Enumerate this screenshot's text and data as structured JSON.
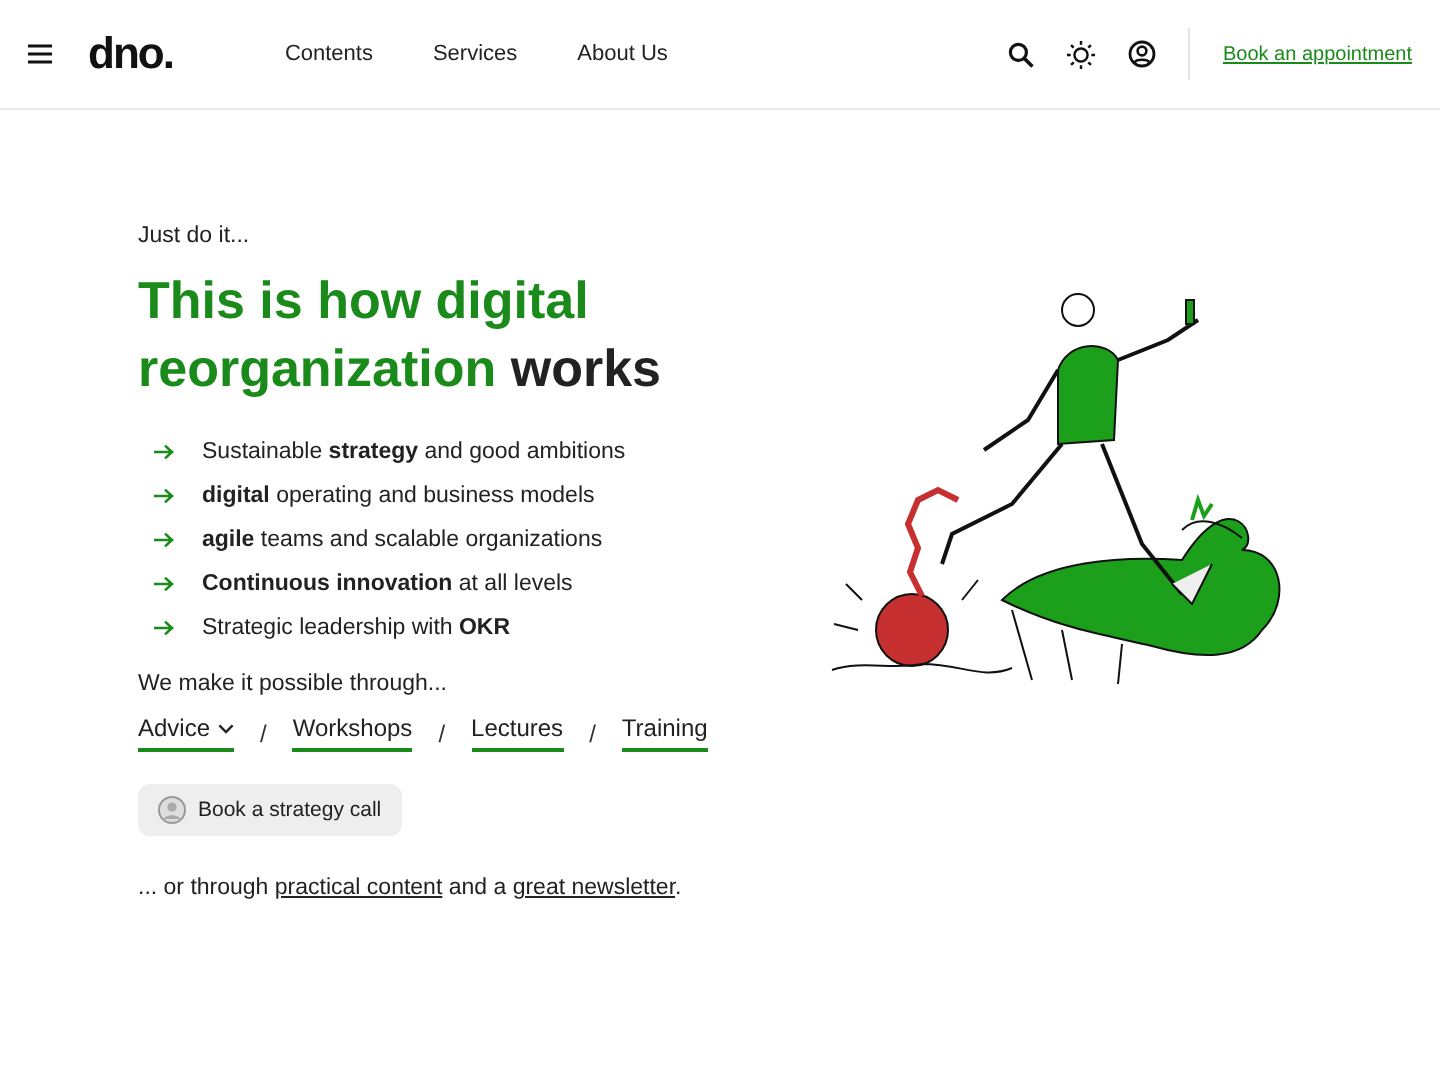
{
  "header": {
    "logo": "dno.",
    "nav": [
      "Contents",
      "Services",
      "About Us"
    ],
    "cta": "Book an appointment"
  },
  "hero": {
    "eyebrow": "Just do it...",
    "heading": {
      "highlight": "This is how digital reorganization",
      "rest": "works"
    },
    "bullets": [
      "Sustainable **strategy** and good ambitions",
      "**digital** operating and business models",
      "**agile** teams and scalable organizations",
      "**Continuous innovation** at all levels",
      "Strategic leadership with **OKR**"
    ],
    "through_label": "We make it possible through...",
    "services": [
      {
        "label": "Advice",
        "dropdown": true
      },
      {
        "label": "Workshops",
        "dropdown": false
      },
      {
        "label": "Lectures",
        "dropdown": false
      },
      {
        "label": "Training",
        "dropdown": false
      }
    ],
    "separator": "/",
    "call_button": "Book a strategy call",
    "footer_text": {
      "before": "... or through ",
      "link1": "practical content",
      "middle": " and a ",
      "link2": "great newsletter",
      "after": "."
    }
  }
}
